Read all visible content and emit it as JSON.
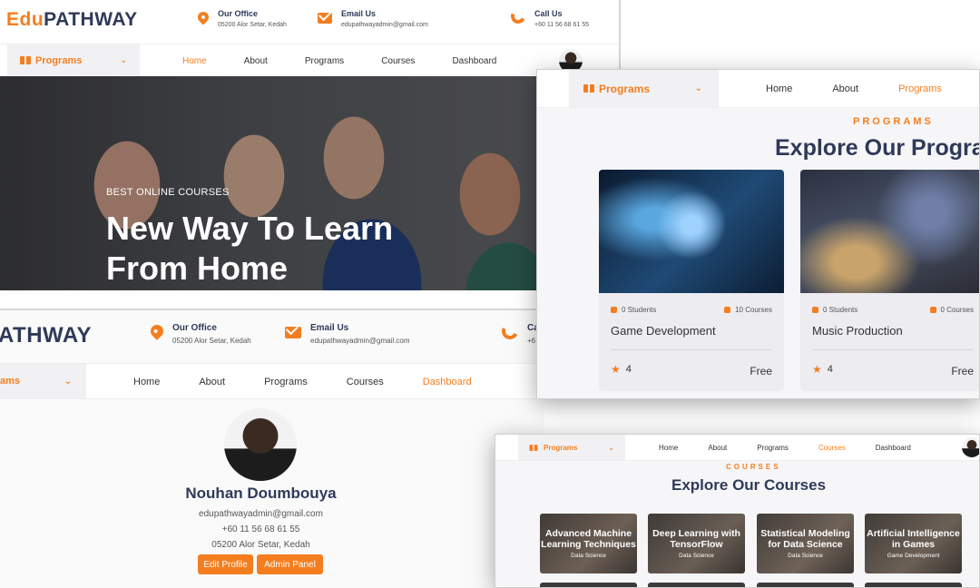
{
  "brand": {
    "edu": "Edu",
    "pathway": "PATHWAY",
    "pathway_cut": "ATHWAY"
  },
  "contact": {
    "office_label": "Our Office",
    "office_value": "05200 Alor Setar, Kedah",
    "email_label": "Email Us",
    "email_value": "edupathwayadmin@gmail.com",
    "call_label": "Call Us",
    "call_value": "+60 11 56 68 61 55",
    "call_label_cut": "Ca",
    "call_value_cut": "+6"
  },
  "nav": {
    "programs_dropdown": "Programs",
    "programs_dropdown_cut": "ams",
    "home": "Home",
    "about": "About",
    "programs": "Programs",
    "courses": "Courses",
    "dashboard": "Dashboard"
  },
  "hero": {
    "kicker": "BEST ONLINE COURSES",
    "line1": "New Way To Learn",
    "line2": "From Home"
  },
  "programs_section": {
    "kicker": "PROGRAMS",
    "title": "Explore Our Progran",
    "cards": [
      {
        "students": "0 Students",
        "courses": "10 Courses",
        "name": "Game Development",
        "rating": "4",
        "price": "Free"
      },
      {
        "students": "0 Students",
        "courses": "0 Courses",
        "name": "Music Production",
        "rating": "4",
        "price": "Free"
      }
    ]
  },
  "profile": {
    "name": "Nouhan Doumbouya",
    "email": "edupathwayadmin@gmail.com",
    "phone": "+60 11 56 68 61 55",
    "address": "05200 Alor Setar, Kedah",
    "edit_button": "Edit Profile",
    "admin_button": "Admin Panel"
  },
  "courses_section": {
    "kicker": "COURSES",
    "title": "Explore Our Courses",
    "cards": [
      {
        "title": "Advanced Machine Learning Techniques",
        "category": "Data Science"
      },
      {
        "title": "Deep Learning with TensorFlow",
        "category": "Data Science"
      },
      {
        "title": "Statistical Modeling for Data Science",
        "category": "Data Science"
      },
      {
        "title": "Artificial Intelligence in Games",
        "category": "Game Development"
      }
    ]
  },
  "colors": {
    "accent": "#f47e1f",
    "navy": "#2f3a59"
  }
}
